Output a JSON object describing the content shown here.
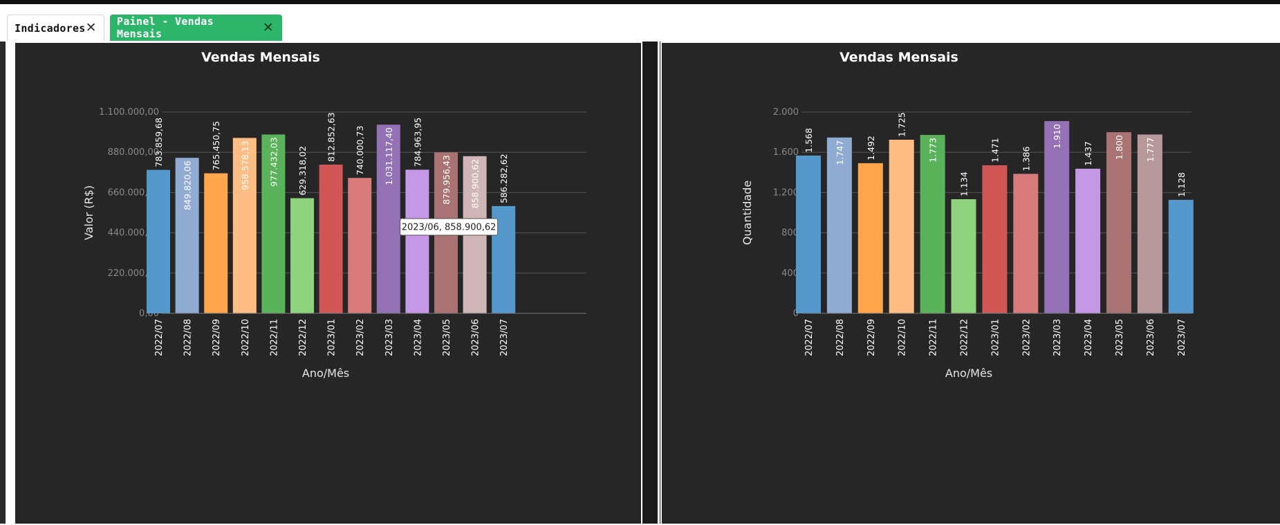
{
  "tabs": [
    {
      "label": "Indicadores",
      "active": false
    },
    {
      "label": "Painel - Vendas Mensais",
      "active": true
    }
  ],
  "tooltip": {
    "text": "2023/06, 858.900,62",
    "series_index": 0,
    "category_index": 11
  },
  "chart_data": [
    {
      "type": "bar",
      "title": "Vendas Mensais",
      "xlabel": "Ano/Mês",
      "ylabel": "Valor (R$)",
      "ylim": [
        0,
        1100000
      ],
      "yticks": [
        0,
        220000,
        440000,
        660000,
        880000,
        1100000
      ],
      "ytick_labels": [
        "0,00",
        "220.000,00",
        "440.000,00",
        "660.000,00",
        "880.000,00",
        "1.100.000,00"
      ],
      "categories": [
        "2022/07",
        "2022/08",
        "2022/09",
        "2022/10",
        "2022/11",
        "2022/12",
        "2023/01",
        "2023/02",
        "2023/03",
        "2023/04",
        "2023/05",
        "2023/06",
        "2023/07"
      ],
      "values": [
        783859.68,
        849820.06,
        765450.75,
        958578.13,
        977432.03,
        629318.02,
        812852.63,
        740000.73,
        1031117.4,
        784963.95,
        879956.43,
        858900.62,
        586282.62
      ],
      "value_labels": [
        "783.859,68",
        "849.820,06",
        "765.450,75",
        "958.578,13",
        "977.432,03",
        "629.318,02",
        "812.852,63",
        "740.000,73",
        "1.031.117,40",
        "784.963,95",
        "879.956,43",
        "858.900,62",
        "586.282,62"
      ],
      "label_position": [
        "outside",
        "inside",
        "outside",
        "inside",
        "inside",
        "outside",
        "outside",
        "outside",
        "inside",
        "outside",
        "inside",
        "inside",
        "outside"
      ],
      "colors": [
        "#5599cc",
        "#90acd2",
        "#ffa54d",
        "#ffbd86",
        "#5ab25a",
        "#8ed27e",
        "#d15757",
        "#d97b7b",
        "#9471b5",
        "#c498e5",
        "#a97373",
        "#d0b6b6",
        "#5599cc"
      ],
      "grid": true,
      "legend": "none"
    },
    {
      "type": "bar",
      "title": "Vendas Mensais",
      "xlabel": "Ano/Mês",
      "ylabel": "Quantidade",
      "ylim": [
        0,
        2000
      ],
      "yticks": [
        0,
        400,
        800,
        1200,
        1600,
        2000
      ],
      "ytick_labels": [
        "0",
        "400",
        "800",
        "1.200",
        "1.600",
        "2.000"
      ],
      "categories": [
        "2022/07",
        "2022/08",
        "2022/09",
        "2022/10",
        "2022/11",
        "2022/12",
        "2023/01",
        "2023/02",
        "2023/03",
        "2023/04",
        "2023/05",
        "2023/06",
        "2023/07"
      ],
      "values": [
        1568,
        1747,
        1492,
        1725,
        1773,
        1134,
        1471,
        1386,
        1910,
        1437,
        1800,
        1777,
        1128
      ],
      "value_labels": [
        "1.568",
        "1.747",
        "1.492",
        "1.725",
        "1.773",
        "1.134",
        "1.471",
        "1.386",
        "1.910",
        "1.437",
        "1.800",
        "1.777",
        "1.128"
      ],
      "label_position": [
        "outside",
        "inside",
        "outside",
        "outside",
        "inside",
        "outside",
        "outside",
        "outside",
        "inside",
        "outside",
        "inside",
        "inside",
        "outside"
      ],
      "colors": [
        "#5599cc",
        "#90acd2",
        "#ffa54d",
        "#ffbd86",
        "#5ab25a",
        "#8ed27e",
        "#d15757",
        "#d97b7b",
        "#9471b5",
        "#c498e5",
        "#a97373",
        "#b8999b",
        "#5599cc"
      ],
      "grid": true,
      "legend": "none"
    }
  ]
}
